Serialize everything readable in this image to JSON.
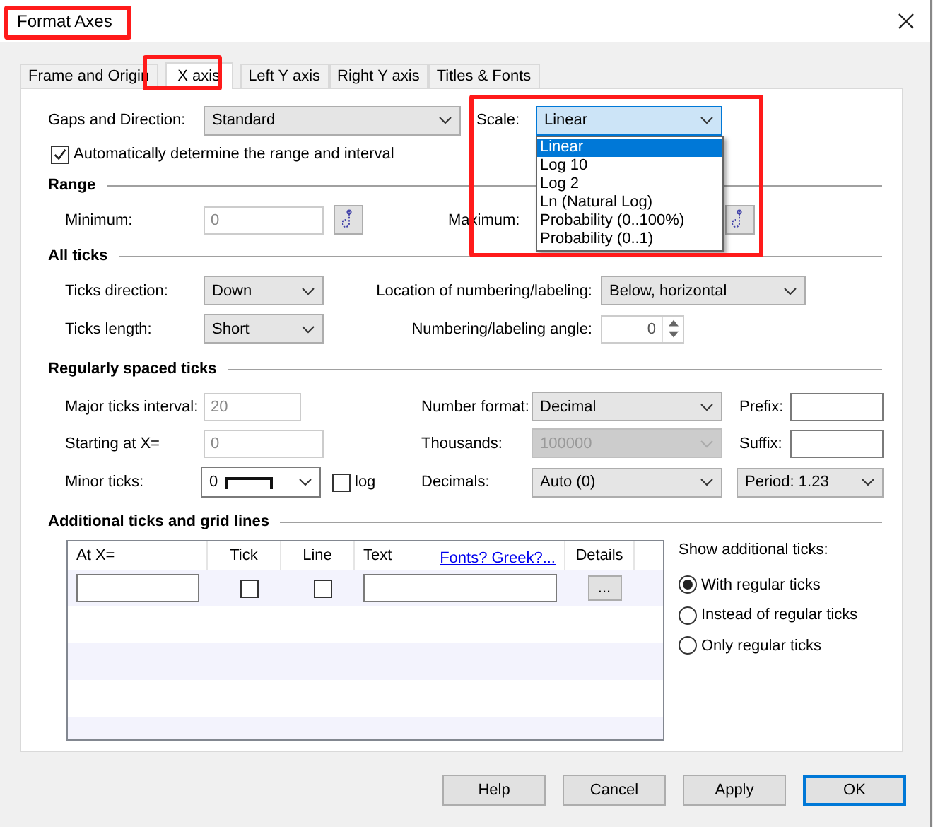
{
  "window": {
    "title": "Format Axes"
  },
  "tabs": [
    {
      "label": "Frame and Origin",
      "selected": false
    },
    {
      "label": "X axis",
      "selected": true
    },
    {
      "label": "Left Y axis",
      "selected": false
    },
    {
      "label": "Right Y axis",
      "selected": false
    },
    {
      "label": "Titles & Fonts",
      "selected": false
    }
  ],
  "gaps_direction": {
    "label": "Gaps and Direction:",
    "value": "Standard"
  },
  "scale": {
    "label": "Scale:",
    "value": "Linear",
    "expanded": true,
    "options": [
      {
        "label": "Linear",
        "selected": true
      },
      {
        "label": "Log 10",
        "selected": false
      },
      {
        "label": "Log 2",
        "selected": false
      },
      {
        "label": "Ln (Natural Log)",
        "selected": false
      },
      {
        "label": "Probability (0..100%)",
        "selected": false
      },
      {
        "label": "Probability (0..1)",
        "selected": false
      }
    ]
  },
  "auto_range": {
    "label": "Automatically determine the range and interval",
    "checked": true
  },
  "range": {
    "title": "Range",
    "minimum": {
      "label": "Minimum:",
      "value": "0",
      "disabled": true
    },
    "maximum": {
      "label": "Maximum:"
    }
  },
  "all_ticks": {
    "title": "All ticks",
    "ticks_direction": {
      "label": "Ticks direction:",
      "value": "Down"
    },
    "ticks_length": {
      "label": "Ticks length:",
      "value": "Short"
    },
    "location": {
      "label": "Location of numbering/labeling:",
      "value": "Below, horizontal"
    },
    "angle": {
      "label": "Numbering/labeling angle:",
      "value": "0"
    }
  },
  "regular": {
    "title": "Regularly spaced ticks",
    "major_interval": {
      "label": "Major ticks interval:",
      "value": "20",
      "disabled": true
    },
    "starting_at": {
      "label": "Starting at X=",
      "value": "0",
      "disabled": true
    },
    "minor_ticks": {
      "label": "Minor ticks:",
      "value": "0"
    },
    "log": {
      "label": "log",
      "checked": false
    },
    "number_format": {
      "label": "Number format:",
      "value": "Decimal",
      "disabled": false
    },
    "thousands": {
      "label": "Thousands:",
      "value": "100000",
      "disabled": true
    },
    "decimals": {
      "label": "Decimals:",
      "value": "Auto (0)",
      "disabled": false
    },
    "prefix": {
      "label": "Prefix:"
    },
    "suffix": {
      "label": "Suffix:"
    },
    "period": {
      "value": "Period: 1.23"
    }
  },
  "additional": {
    "title": "Additional ticks and grid lines",
    "columns": [
      "At X=",
      "Tick",
      "Line",
      "Text",
      "Details"
    ],
    "link": "Fonts? Greek?...",
    "row": {
      "tick": false,
      "line": false,
      "details": "..."
    },
    "show_label": "Show additional ticks:",
    "radios": [
      {
        "label": "With regular ticks",
        "selected": true
      },
      {
        "label": "Instead of regular ticks",
        "selected": false
      },
      {
        "label": "Only regular ticks",
        "selected": false
      }
    ]
  },
  "buttons": [
    {
      "label": "Help",
      "default": false
    },
    {
      "label": "Cancel",
      "default": false
    },
    {
      "label": "Apply",
      "default": false
    },
    {
      "label": "OK",
      "default": true
    }
  ]
}
